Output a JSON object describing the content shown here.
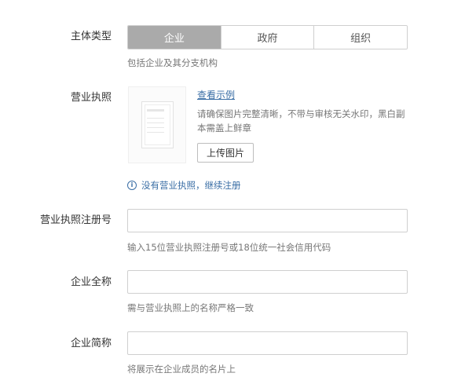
{
  "entity_type": {
    "label": "主体类型",
    "options": [
      "企业",
      "政府",
      "组织"
    ],
    "selected": "企业",
    "hint": "包括企业及其分支机构"
  },
  "business_license": {
    "label": "营业执照",
    "example_link": "查看示例",
    "description": "请确保图片完整清晰，不带与审核无关水印，黑白副本需盖上鲜章",
    "upload_button": "上传图片",
    "no_license_link": "没有营业执照，继续注册",
    "info_icon": "info-icon"
  },
  "registration_number": {
    "label": "营业执照注册号",
    "value": "",
    "hint": "输入15位营业执照注册号或18位统一社会信用代码"
  },
  "full_name": {
    "label": "企业全称",
    "value": "",
    "hint": "需与营业执照上的名称严格一致"
  },
  "short_name": {
    "label": "企业简称",
    "value": "",
    "hint": "将展示在企业成员的名片上"
  },
  "colors": {
    "active_segment": "#aaaaaa",
    "link": "#3a6ea5",
    "border": "#cfcfcf",
    "hint_text": "#777777"
  }
}
